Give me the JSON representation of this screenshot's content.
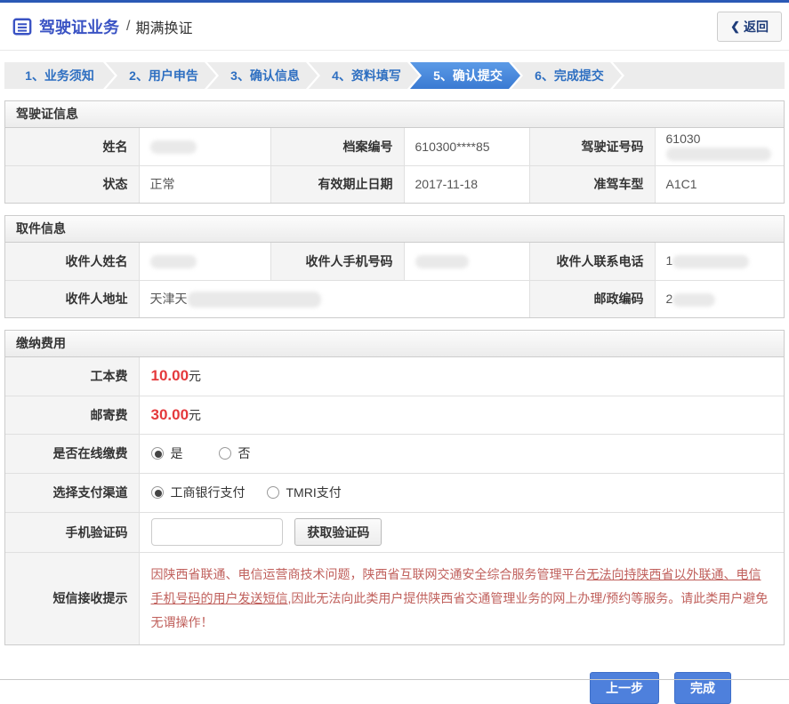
{
  "header": {
    "title": "驾驶证业务",
    "separator": "/",
    "subtitle": "期满换证",
    "back": {
      "chevron": "❮",
      "label": "返回"
    }
  },
  "wizard": {
    "steps": [
      {
        "label": "1、业务须知",
        "active": false
      },
      {
        "label": "2、用户申告",
        "active": false
      },
      {
        "label": "3、确认信息",
        "active": false
      },
      {
        "label": "4、资料填写",
        "active": false
      },
      {
        "label": "5、确认提交",
        "active": true
      },
      {
        "label": "6、完成提交",
        "active": false
      }
    ]
  },
  "license": {
    "title": "驾驶证信息",
    "name_label": "姓名",
    "file_no_label": "档案编号",
    "file_no_value": "610300****85",
    "license_no_label": "驾驶证号码",
    "license_no_prefix": "61030",
    "status_label": "状态",
    "status_value": "正常",
    "valid_until_label": "有效期止日期",
    "valid_until_value": "2017-11-18",
    "vehicle_class_label": "准驾车型",
    "vehicle_class_value": "A1C1"
  },
  "pickup": {
    "title": "取件信息",
    "recipient_name_label": "收件人姓名",
    "recipient_mobile_label": "收件人手机号码",
    "recipient_phone_label": "收件人联系电话",
    "recipient_phone_prefix": "1",
    "address_label": "收件人地址",
    "address_prefix": "天津天",
    "postcode_label": "邮政编码",
    "postcode_prefix": "2"
  },
  "fees": {
    "title": "缴纳费用",
    "production_fee_label": "工本费",
    "production_fee_value": "10.00",
    "postage_fee_label": "邮寄费",
    "postage_fee_value": "30.00",
    "currency_unit": "元",
    "online_payment_label": "是否在线缴费",
    "online_yes": "是",
    "online_no": "否",
    "online_selected": "是",
    "channel_label": "选择支付渠道",
    "channel_icbc": "工商银行支付",
    "channel_tmri": "TMRI支付",
    "channel_selected": "工商银行支付",
    "sms_code_label": "手机验证码",
    "sms_code_value": "",
    "get_code_button": "获取验证码",
    "notice_label": "短信接收提示",
    "notice_part1": "因陕西省联通、电信运营商技术问题，陕西省互联网交通安全综合服务管理平台",
    "notice_part2": "无法向持陕西省以外联通、电信手机号码的用户发送短信,",
    "notice_part3": "因此无法向此类用户提供陕西省交通管理业务的网上办理/预约等服务。请此类用户避免无谓操作！"
  },
  "footer": {
    "prev_label": "上一步",
    "finish_label": "完成"
  },
  "colors": {
    "top_bar": "#2b59b5",
    "title_blue": "#3a53c4",
    "step_text_blue": "#2e6fc1",
    "active_step_blue": "#3a7ad2",
    "fee_red": "#e4393c",
    "notice_red": "#c0605c",
    "button_blue": "#4e80dc"
  }
}
